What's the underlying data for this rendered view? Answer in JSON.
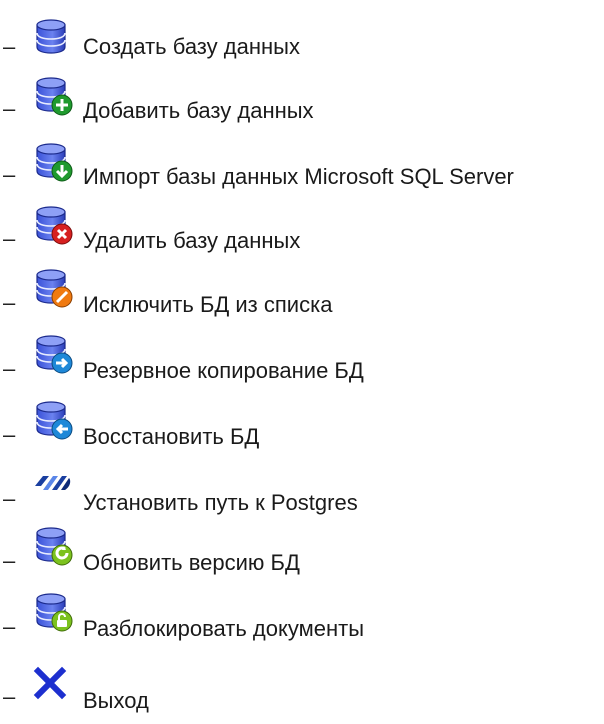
{
  "menu": {
    "bullet": "–",
    "items": [
      {
        "label": "Создать базу данных",
        "icon": "database-icon"
      },
      {
        "label": "Добавить базу данных",
        "icon": "database-add-icon",
        "badge_color": "#1f9a2e"
      },
      {
        "label": "Импорт базы данных Microsoft SQL Server",
        "icon": "database-import-icon",
        "badge_color": "#1f9a2e"
      },
      {
        "label": "Удалить базу данных",
        "icon": "database-delete-icon",
        "badge_color": "#d62020"
      },
      {
        "label": "Исключить БД из списка",
        "icon": "database-exclude-icon",
        "badge_color": "#f07a10"
      },
      {
        "label": "Резервное копирование БД",
        "icon": "database-backup-icon",
        "badge_color": "#1e88d8"
      },
      {
        "label": "Восстановить БД",
        "icon": "database-restore-icon",
        "badge_color": "#1e88d8"
      },
      {
        "label": "Установить путь к Postgres",
        "icon": "postgres-path-icon"
      },
      {
        "label": "Обновить версию БД",
        "icon": "database-update-icon",
        "badge_color": "#7cc21e"
      },
      {
        "label": "Разблокировать документы",
        "icon": "database-unlock-icon",
        "badge_color": "#7cc21e"
      },
      {
        "label": "Выход",
        "icon": "exit-icon"
      }
    ]
  }
}
